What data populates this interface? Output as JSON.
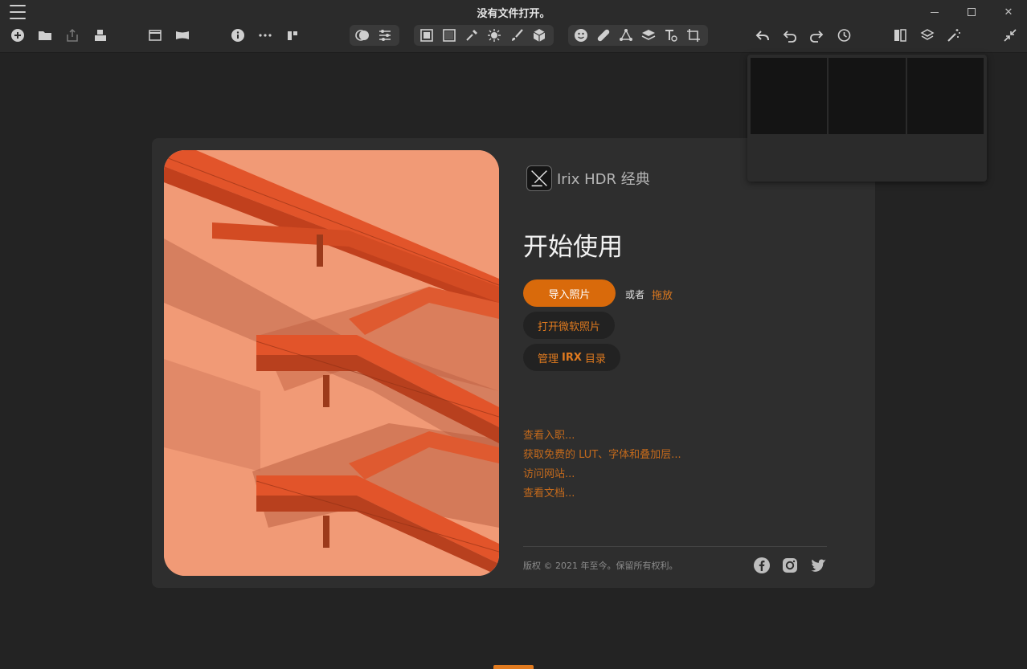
{
  "window": {
    "title": "没有文件打开。",
    "minimize_icon": "minimize-icon",
    "maximize_icon": "maximize-icon",
    "close_icon": "close-icon"
  },
  "toolbar": {
    "left_icons": [
      "add-icon",
      "folder-icon",
      "export-icon",
      "batch-icon",
      "window-icon",
      "panorama-icon",
      "info-icon",
      "more-icon",
      "compare-icon"
    ],
    "group1_icons": [
      "blend-icon",
      "sliders-icon"
    ],
    "group2_icons": [
      "frame-icon",
      "vignette-icon",
      "eyedropper-icon",
      "brightness-icon",
      "brush-icon",
      "cube-icon"
    ],
    "group3_icons": [
      "face-icon",
      "healing-icon",
      "network-icon",
      "layers-icon",
      "text-icon",
      "crop-icon"
    ],
    "right_icons": [
      "back-icon",
      "undo-icon",
      "redo-icon",
      "history-icon",
      "split-view-icon",
      "stack-icon",
      "magic-wand-icon",
      "collapse-icon"
    ]
  },
  "welcome": {
    "brand_name": "Irix HDR 经典",
    "title": "开始使用",
    "import_label": "导入照片",
    "or_label": "或者",
    "drag_label": "拖放",
    "ms_photos_label": "打开微软照片",
    "catalog_prefix": "管理 ",
    "catalog_bold": "IRX",
    "catalog_suffix": " 目录",
    "links": [
      "查看入职...",
      "获取免费的 LUT、字体和叠加层...",
      "访问网站...",
      "查看文档..."
    ],
    "copyright": "版权 © 2021 年至今。保留所有权利。",
    "social": [
      "facebook-icon",
      "instagram-icon",
      "twitter-icon"
    ]
  },
  "colors": {
    "accent": "#d96a0b",
    "link": "#c46a1c",
    "background": "#232323",
    "card": "#2e2e2e",
    "hero": "#f19a76"
  }
}
